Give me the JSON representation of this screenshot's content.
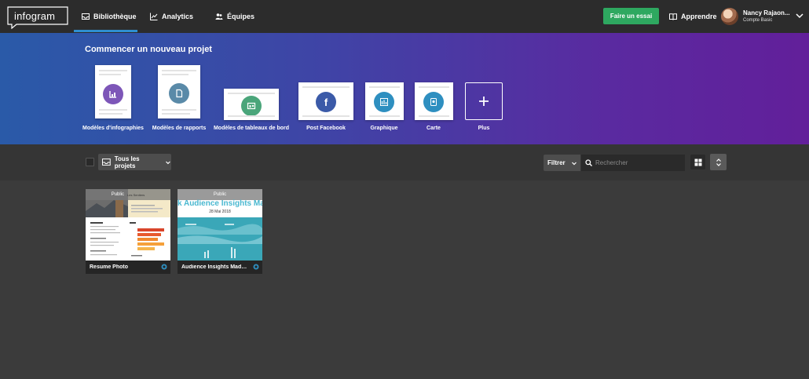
{
  "topbar": {
    "logo": "infogram",
    "nav": [
      {
        "label": "Bibliothèque",
        "icon": "inbox-icon"
      },
      {
        "label": "Analytics",
        "icon": "line-chart-icon"
      },
      {
        "label": "Équipes",
        "icon": "team-icon"
      }
    ],
    "trial_button": "Faire un essai",
    "learn": "Apprendre",
    "user_name": "Nancy Rajaon...",
    "user_plan": "Compte Basic"
  },
  "banner": {
    "title": "Commencer un nouveau projet",
    "templates": [
      {
        "label": "Modèles d'infographies",
        "icon": "infographic-icon",
        "color": "#7d56b8"
      },
      {
        "label": "Modèles de rapports",
        "icon": "report-icon",
        "color": "#5a8aa8"
      },
      {
        "label": "Modèles de tableaux de bord",
        "icon": "dashboard-icon",
        "color": "#4aa57a"
      },
      {
        "label": "Post Facebook",
        "icon": "facebook-icon",
        "color": "#3b5aa8"
      },
      {
        "label": "Graphique",
        "icon": "chart-icon",
        "color": "#2e8fc0"
      },
      {
        "label": "Carte",
        "icon": "map-icon",
        "color": "#2e8fc0"
      },
      {
        "label": "Plus",
        "icon": "plus-icon"
      }
    ]
  },
  "filterbar": {
    "all_projects": "Tous les projets",
    "filter": "Filtrer",
    "search_placeholder": "Rechercher"
  },
  "projects": [
    {
      "name": "Resume Photo",
      "badge": "Public",
      "thumb_header": "Les Sentiers"
    },
    {
      "name": "Audience Insights Mada...",
      "badge": "Public",
      "thumb_title": "k Audience Insights Mad",
      "thumb_date": "28 Mai 2018"
    }
  ]
}
